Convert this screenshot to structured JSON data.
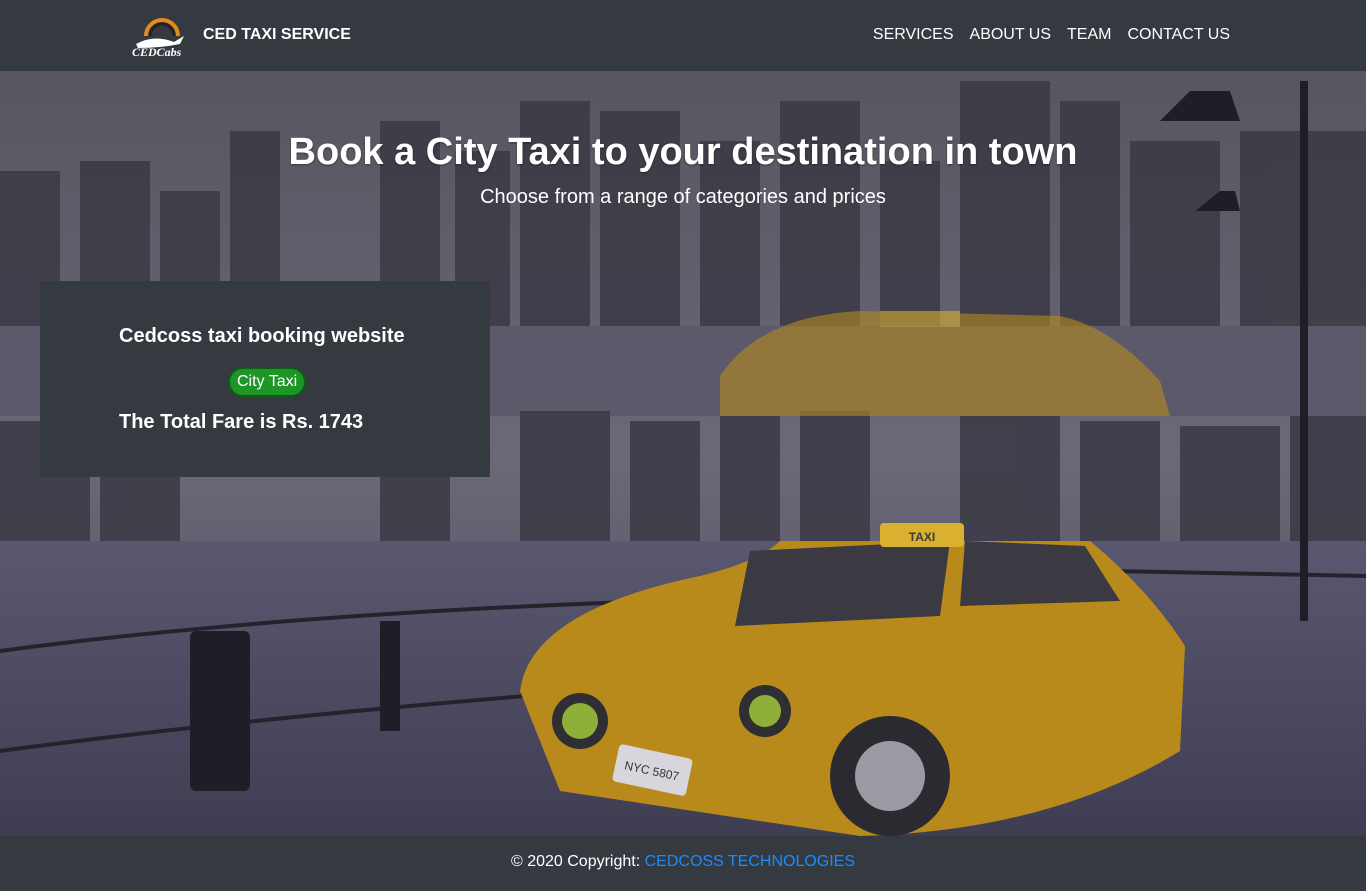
{
  "navbar": {
    "brand_name": "CED TAXI SERVICE",
    "logo_text": "CEDCabs",
    "links": [
      "SERVICES",
      "ABOUT US",
      "TEAM",
      "CONTACT US"
    ]
  },
  "hero": {
    "title": "Book a City Taxi to your destination in town",
    "subtitle": "Choose from a range of categories and prices"
  },
  "booking": {
    "title": "Cedcoss taxi booking website",
    "cab_type_label": "City Taxi",
    "fare_text": "The Total Fare is Rs. 1743"
  },
  "taxi_sign": "TAXI",
  "plate": "NYC 5807",
  "footer": {
    "copyright": "© 2020 Copyright: ",
    "company_link": "CEDCOSS TECHNOLOGIES"
  },
  "colors": {
    "navbar_bg": "#343a40",
    "button_green": "#1e9627",
    "link_blue": "#1a8cff",
    "taxi_yellow": "#c99a1c"
  },
  "icons": [
    "cedcabs-logo-icon"
  ]
}
